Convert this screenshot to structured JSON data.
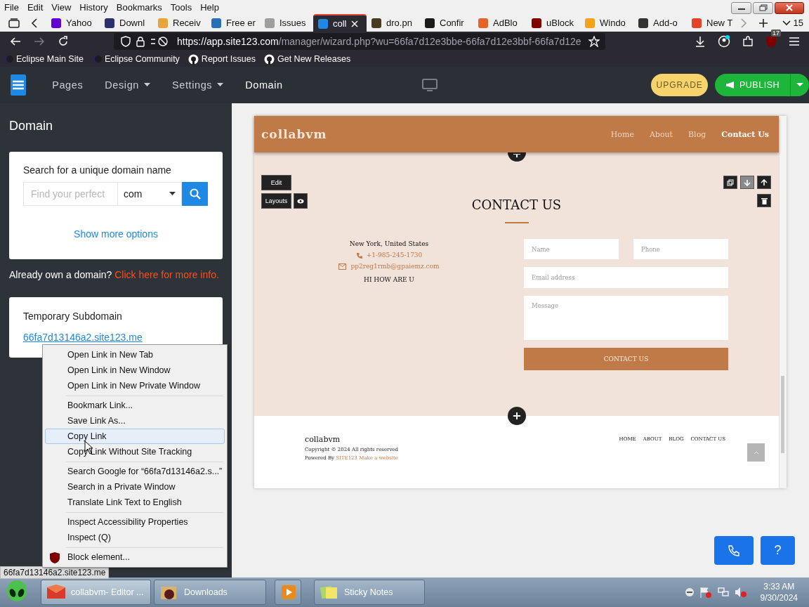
{
  "menubar": [
    "File",
    "Edit",
    "View",
    "History",
    "Bookmarks",
    "Tools",
    "Help"
  ],
  "tabs": [
    {
      "label": "Yahoo",
      "selected": false,
      "color": "#6001d2"
    },
    {
      "label": "Downl",
      "selected": false,
      "color": "#2b2f6b"
    },
    {
      "label": "Receiv",
      "selected": false,
      "color": "#e8a33d"
    },
    {
      "label": "Free er",
      "selected": false,
      "color": "#2a6fb5"
    },
    {
      "label": "Issues",
      "selected": false,
      "color": "#9e9e9e"
    },
    {
      "label": "coll",
      "selected": true,
      "color": "#1e88e5"
    },
    {
      "label": "dro.pn",
      "selected": false,
      "color": "#4a3b1e"
    },
    {
      "label": "Confir",
      "selected": false,
      "color": "#1a1a1a"
    },
    {
      "label": "AdBlo",
      "selected": false,
      "color": "#e8622c"
    },
    {
      "label": "uBlock",
      "selected": false,
      "color": "#800000"
    },
    {
      "label": "Windo",
      "selected": false,
      "color": "#f4a21b"
    },
    {
      "label": "Add-o",
      "selected": false,
      "color": "#333333"
    },
    {
      "label": "New T",
      "selected": false,
      "color": "#e24329"
    }
  ],
  "tab_count": "15",
  "address": {
    "host": "https://app.site123.com",
    "path": "/manager/wizard.php?wu=66fa7d12e3bbe-66fa7d12e3bbf-66fa7d12e"
  },
  "extension_badge": "17",
  "bookmarks": [
    {
      "label": "Eclipse Main Site",
      "kind": "eclipse"
    },
    {
      "label": "Eclipse Community",
      "kind": "eclipse"
    },
    {
      "label": "Report Issues",
      "kind": "github"
    },
    {
      "label": "Get New Releases",
      "kind": "github"
    }
  ],
  "editor": {
    "nav": [
      {
        "label": "Pages",
        "dropdown": false,
        "selected": false
      },
      {
        "label": "Design",
        "dropdown": true,
        "selected": false
      },
      {
        "label": "Settings",
        "dropdown": true,
        "selected": false
      },
      {
        "label": "Domain",
        "dropdown": false,
        "selected": true
      }
    ],
    "upgrade": "UPGRADE",
    "publish": "PUBLISH"
  },
  "sidebar": {
    "title": "Domain",
    "search_label": "Search for a unique domain name",
    "search_placeholder": "Find your perfect",
    "tld": "com",
    "more_options": "Show more options",
    "own_text": "Already own a domain?",
    "own_link": "Click here for more info.",
    "temp_title": "Temporary Subdomain",
    "temp_link": "66fa7d13146a2.site123.me"
  },
  "preview": {
    "brand": "collabvm",
    "nav": [
      {
        "label": "Home",
        "selected": false
      },
      {
        "label": "About",
        "selected": false
      },
      {
        "label": "Blog",
        "selected": false
      },
      {
        "label": "Contact Us",
        "selected": true
      }
    ],
    "edit": "Edit",
    "layouts": "Layouts",
    "heading": "CONTACT US",
    "address": "New York, United States",
    "phone": "+1-985-245-1730",
    "email": "pp2reg1rmb@gpaiemz.com",
    "note": "HI HOW ARE U",
    "form": {
      "name": {
        "placeholder": "Name"
      },
      "phone": {
        "placeholder": "Phone"
      },
      "email": {
        "placeholder": "Email address"
      },
      "message": {
        "placeholder": "Message"
      },
      "submit": "CONTACT US"
    },
    "footer": {
      "brand": "collabvm",
      "copyright": "Copyright © 2024 All rights reserved",
      "powered": "Powered By",
      "powered_link": "SITE123",
      "make": "Make a website",
      "nav": [
        "HOME",
        "ABOUT",
        "BLOG",
        "CONTACT US"
      ]
    }
  },
  "context_menu": [
    [
      {
        "label": "Open Link in New Tab",
        "selected": false,
        "kind": "plain"
      },
      {
        "label": "Open Link in New Window",
        "selected": false,
        "kind": "plain"
      },
      {
        "label": "Open Link in New Private Window",
        "selected": false,
        "kind": "plain"
      }
    ],
    [
      {
        "label": "Bookmark Link...",
        "selected": false,
        "kind": "plain"
      },
      {
        "label": "Save Link As...",
        "selected": false,
        "kind": "plain"
      },
      {
        "label": "Copy Link",
        "selected": true,
        "kind": "plain"
      },
      {
        "label": "Copy Link Without Site Tracking",
        "selected": false,
        "kind": "plain"
      }
    ],
    [
      {
        "label": "Search Google for “66fa7d13146a2.s...”",
        "selected": false,
        "kind": "plain"
      },
      {
        "label": "Search in a Private Window",
        "selected": false,
        "kind": "plain"
      },
      {
        "label": "Translate Link Text to English",
        "selected": false,
        "kind": "plain"
      }
    ],
    [
      {
        "label": "Inspect Accessibility Properties",
        "selected": false,
        "kind": "plain"
      },
      {
        "label": "Inspect (Q)",
        "selected": false,
        "kind": "plain"
      }
    ],
    [
      {
        "label": "Block element...",
        "selected": false,
        "kind": "extension"
      }
    ]
  ],
  "status_link": "66fa7d13146a2.site123.me",
  "help_button": "?",
  "taskbar": {
    "tasks": [
      {
        "label": "collabvm- Editor ...",
        "selected": true,
        "kind": "browser"
      },
      {
        "label": "Downloads",
        "selected": false,
        "kind": "folder"
      },
      {
        "selected": false,
        "kind": "media"
      },
      {
        "label": "Sticky Notes",
        "selected": false,
        "kind": "notes"
      }
    ],
    "time": "3:33 AM",
    "date": "9/30/2024"
  }
}
